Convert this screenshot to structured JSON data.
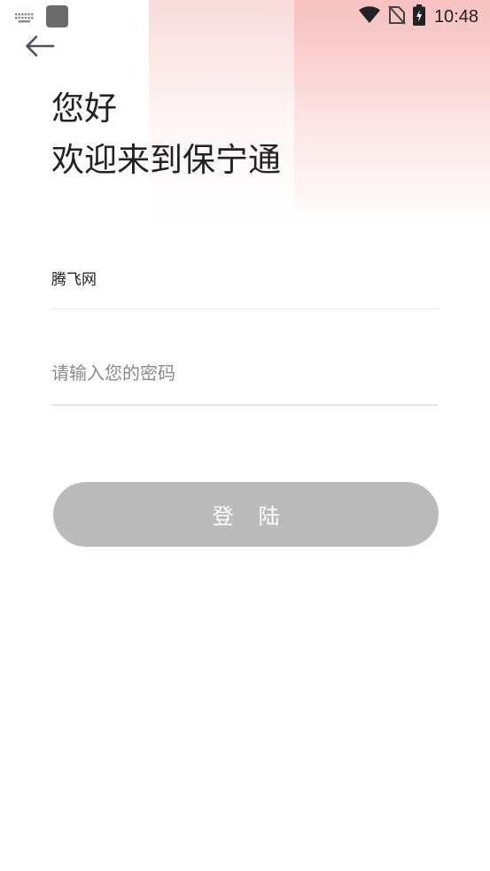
{
  "status_bar": {
    "time": "10:48",
    "icons": [
      "keyboard-icon",
      "app-square-icon",
      "wifi-icon",
      "no-sim-icon",
      "battery-charging-icon"
    ]
  },
  "header": {
    "back_icon": "arrow-left-icon"
  },
  "greeting": {
    "line1": "您好",
    "line2": "欢迎来到保宁通"
  },
  "form": {
    "username_value": "腾飞网",
    "password_placeholder": "请输入您的密码",
    "login_label": "登陆"
  },
  "colors": {
    "button_bg": "#bbbbbb",
    "accent_gradient": "#f5aaaa"
  }
}
